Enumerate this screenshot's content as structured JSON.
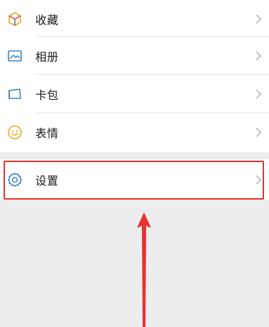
{
  "menu": {
    "items": [
      {
        "label": "收藏",
        "icon": "favorites-cube-icon"
      },
      {
        "label": "相册",
        "icon": "album-picture-icon"
      },
      {
        "label": "卡包",
        "icon": "card-wallet-icon"
      },
      {
        "label": "表情",
        "icon": "smiley-face-icon"
      }
    ],
    "settings": {
      "label": "设置",
      "icon": "gear-icon"
    }
  },
  "annotation": {
    "highlight_color": "#e8312f",
    "arrow_color": "#e8312f"
  },
  "colors": {
    "background": "#ededed",
    "row_background": "#ffffff",
    "text": "#1a1a1a",
    "chevron": "#b2b2b2",
    "icon_blue": "#3b82c4",
    "icon_orange": "#f1a526"
  }
}
